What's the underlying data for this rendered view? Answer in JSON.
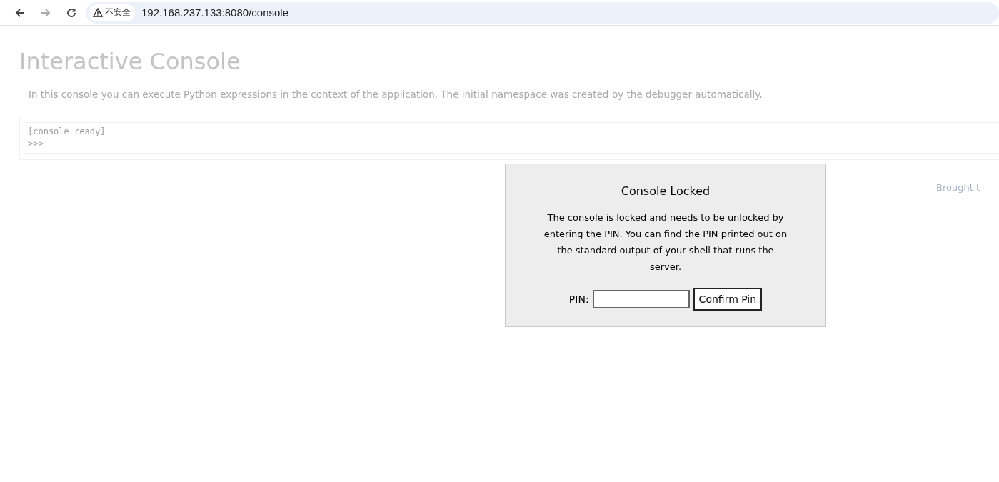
{
  "browser": {
    "security_label": "不安全",
    "address": "192.168.237.133:8080/console"
  },
  "page": {
    "title": "Interactive Console",
    "explanation": "In this console you can execute Python expressions in the context of the application. The initial namespace was created by the debugger automatically.",
    "console_lines": [
      "[console ready]",
      ">>>"
    ],
    "footer": "Brought t"
  },
  "dialog": {
    "title": "Console Locked",
    "message": "The console is locked and needs to be unlocked by entering the PIN. You can find the PIN printed out on the standard output of your shell that runs the server.",
    "pin_label": "PIN:",
    "button": "Confirm Pin"
  }
}
